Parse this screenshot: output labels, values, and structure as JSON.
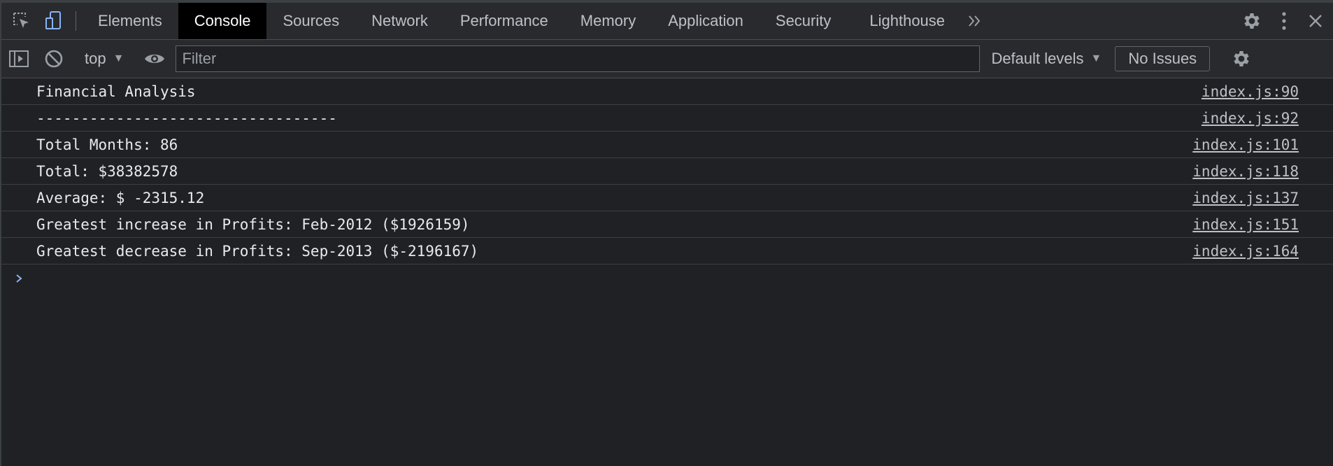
{
  "tabs": [
    {
      "label": "Elements",
      "active": false
    },
    {
      "label": "Console",
      "active": true
    },
    {
      "label": "Sources",
      "active": false
    },
    {
      "label": "Network",
      "active": false
    },
    {
      "label": "Performance",
      "active": false
    },
    {
      "label": "Memory",
      "active": false
    },
    {
      "label": "Application",
      "active": false
    },
    {
      "label": "Security",
      "active": false
    },
    {
      "label": "Lighthouse",
      "active": false
    }
  ],
  "toolbar": {
    "context": "top",
    "filter_placeholder": "Filter",
    "levels": "Default levels",
    "issues": "No Issues"
  },
  "messages": [
    {
      "text": "Financial Analysis",
      "source": "index.js:90"
    },
    {
      "text": "----------------------------------",
      "source": "index.js:92"
    },
    {
      "text": "Total Months: 86",
      "source": "index.js:101"
    },
    {
      "text": "Total: $38382578",
      "source": "index.js:118"
    },
    {
      "text": "Average: $ -2315.12",
      "source": "index.js:137"
    },
    {
      "text": "Greatest increase in Profits: Feb-2012 ($1926159)",
      "source": "index.js:151"
    },
    {
      "text": "Greatest decrease in Profits: Sep-2013 ($-2196167)",
      "source": "index.js:164"
    }
  ],
  "icons": {
    "inspect": "inspect-element-icon",
    "device": "device-toolbar-icon",
    "more_tabs": "more-tabs-icon",
    "settings": "gear-icon",
    "menu": "kebab-menu-icon",
    "close": "close-icon",
    "sidebar": "sidebar-toggle-icon",
    "clear": "clear-console-icon",
    "eye": "live-expression-icon",
    "prompt": "prompt-chevron-icon"
  },
  "colors": {
    "background": "#202124",
    "tabbar": "#292a2d",
    "active_tab": "#000000",
    "prompt": "#8ab4f8"
  }
}
